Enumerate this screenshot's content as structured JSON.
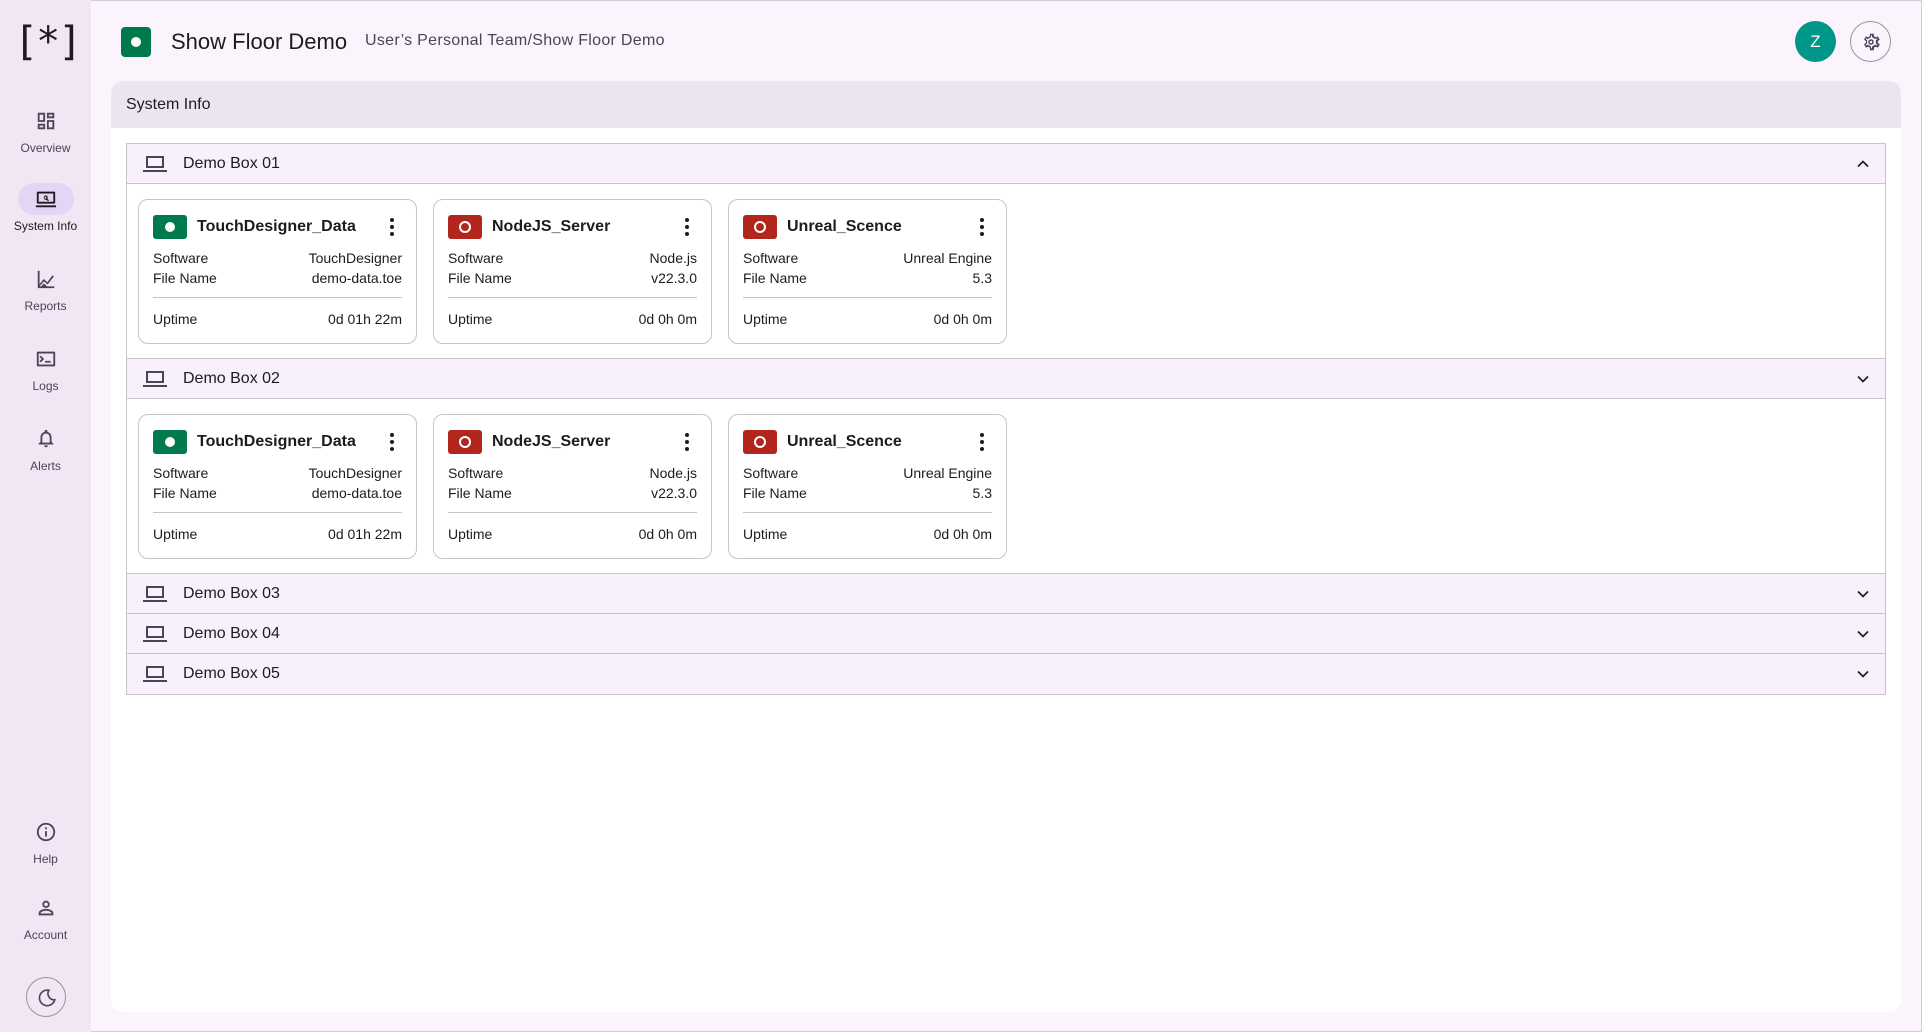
{
  "sidebar": {
    "logo": "[*]",
    "items": [
      {
        "label": "Overview",
        "icon": "dashboard-icon"
      },
      {
        "label": "System Info",
        "icon": "system-info-icon",
        "active": true
      },
      {
        "label": "Reports",
        "icon": "reports-icon"
      },
      {
        "label": "Logs",
        "icon": "terminal-icon"
      },
      {
        "label": "Alerts",
        "icon": "bell-icon"
      },
      {
        "label": "Help",
        "icon": "info-icon"
      },
      {
        "label": "Account",
        "icon": "person-icon"
      }
    ],
    "theme_icon": "moon-icon"
  },
  "header": {
    "title": "Show Floor Demo",
    "path": "User’s Personal Team/Show Floor Demo",
    "avatar_letter": "Z",
    "status_color": "#007a4d"
  },
  "main": {
    "title": "System Info",
    "boxes": [
      {
        "name": "Demo Box 01",
        "expanded": true,
        "cards": [
          {
            "name": "TouchDesigner_Data",
            "status": "running",
            "software_label": "Software",
            "software": "TouchDesigner",
            "file_label": "File Name",
            "file": "demo-data.toe",
            "uptime_label": "Uptime",
            "uptime": "0d 01h 22m"
          },
          {
            "name": "NodeJS_Server",
            "status": "stopped",
            "software_label": "Software",
            "software": "Node.js",
            "file_label": "File Name",
            "file": "v22.3.0",
            "uptime_label": "Uptime",
            "uptime": "0d 0h 0m"
          },
          {
            "name": "Unreal_Scence",
            "status": "stopped",
            "software_label": "Software",
            "software": "Unreal Engine",
            "file_label": "File Name",
            "file": "5.3",
            "uptime_label": "Uptime",
            "uptime": "0d 0h 0m"
          }
        ]
      },
      {
        "name": "Demo Box 02",
        "expanded": true,
        "cards": [
          {
            "name": "TouchDesigner_Data",
            "status": "running",
            "software_label": "Software",
            "software": "TouchDesigner",
            "file_label": "File Name",
            "file": "demo-data.toe",
            "uptime_label": "Uptime",
            "uptime": "0d 01h 22m"
          },
          {
            "name": "NodeJS_Server",
            "status": "stopped",
            "software_label": "Software",
            "software": "Node.js",
            "file_label": "File Name",
            "file": "v22.3.0",
            "uptime_label": "Uptime",
            "uptime": "0d 0h 0m"
          },
          {
            "name": "Unreal_Scence",
            "status": "stopped",
            "software_label": "Software",
            "software": "Unreal Engine",
            "file_label": "File Name",
            "file": "5.3",
            "uptime_label": "Uptime",
            "uptime": "0d 0h 0m"
          }
        ]
      },
      {
        "name": "Demo Box 03",
        "expanded": false
      },
      {
        "name": "Demo Box 04",
        "expanded": false
      },
      {
        "name": "Demo Box 05",
        "expanded": false
      }
    ]
  },
  "colors": {
    "running": "#007a4d",
    "stopped": "#b3261e",
    "avatar": "#009688",
    "nav_active": "#e5d5f5"
  }
}
